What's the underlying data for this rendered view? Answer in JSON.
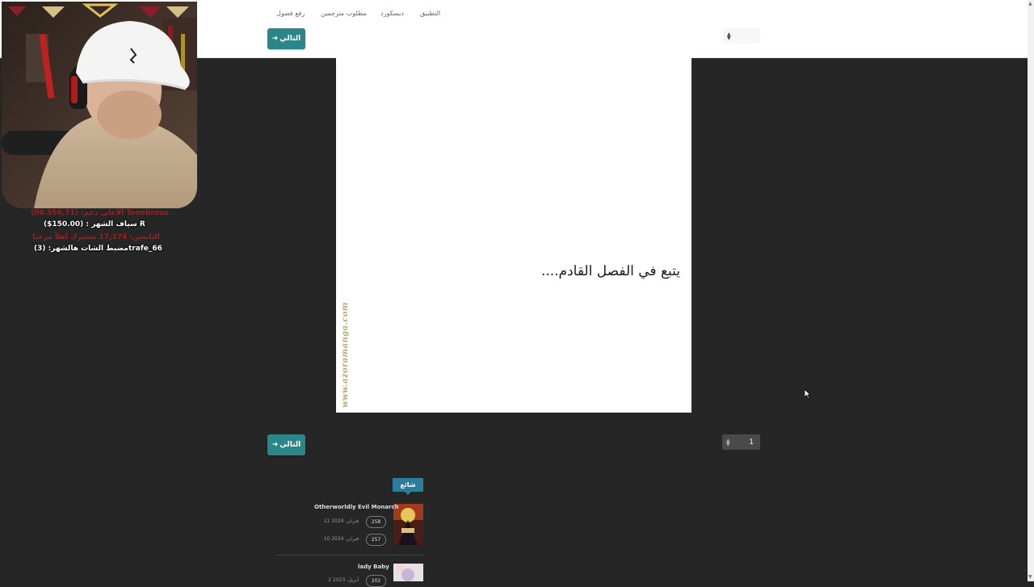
{
  "nav": {
    "links": [
      "رفع فصول",
      "مطلوب مترجمين",
      "ديسكورد",
      "التطبيق"
    ]
  },
  "reader": {
    "next_label": "التالي",
    "page_select_value": "1",
    "comic_text": "يتبع في الفصل القادم....",
    "watermark": "www.azoramanga.com"
  },
  "stream_overlay": {
    "lines": [
      "الأعلى دعم: (00.550,71) Tenebrous",
      "سياف الشهر : (150.00$) R",
      "التابعين: 17,174 مشترك أهلاً مرحبا",
      "مضبط الشات هالشهر: (3)trafe_66"
    ]
  },
  "trending": {
    "label": "شائع",
    "items": [
      {
        "title": "Otherworldly Evil Monarch",
        "chapters": [
          {
            "number": "258",
            "date": "11 فبراير، 2024"
          },
          {
            "number": "257",
            "date": "10 فبراير، 2024"
          }
        ]
      },
      {
        "title": "lady Baby",
        "chapters": [
          {
            "number": "202",
            "date": "2 أبريل، 2023"
          }
        ]
      }
    ]
  },
  "colors": {
    "accent": "#2a8689",
    "page_bg": "#262626",
    "badge": "#2b7e9a"
  }
}
